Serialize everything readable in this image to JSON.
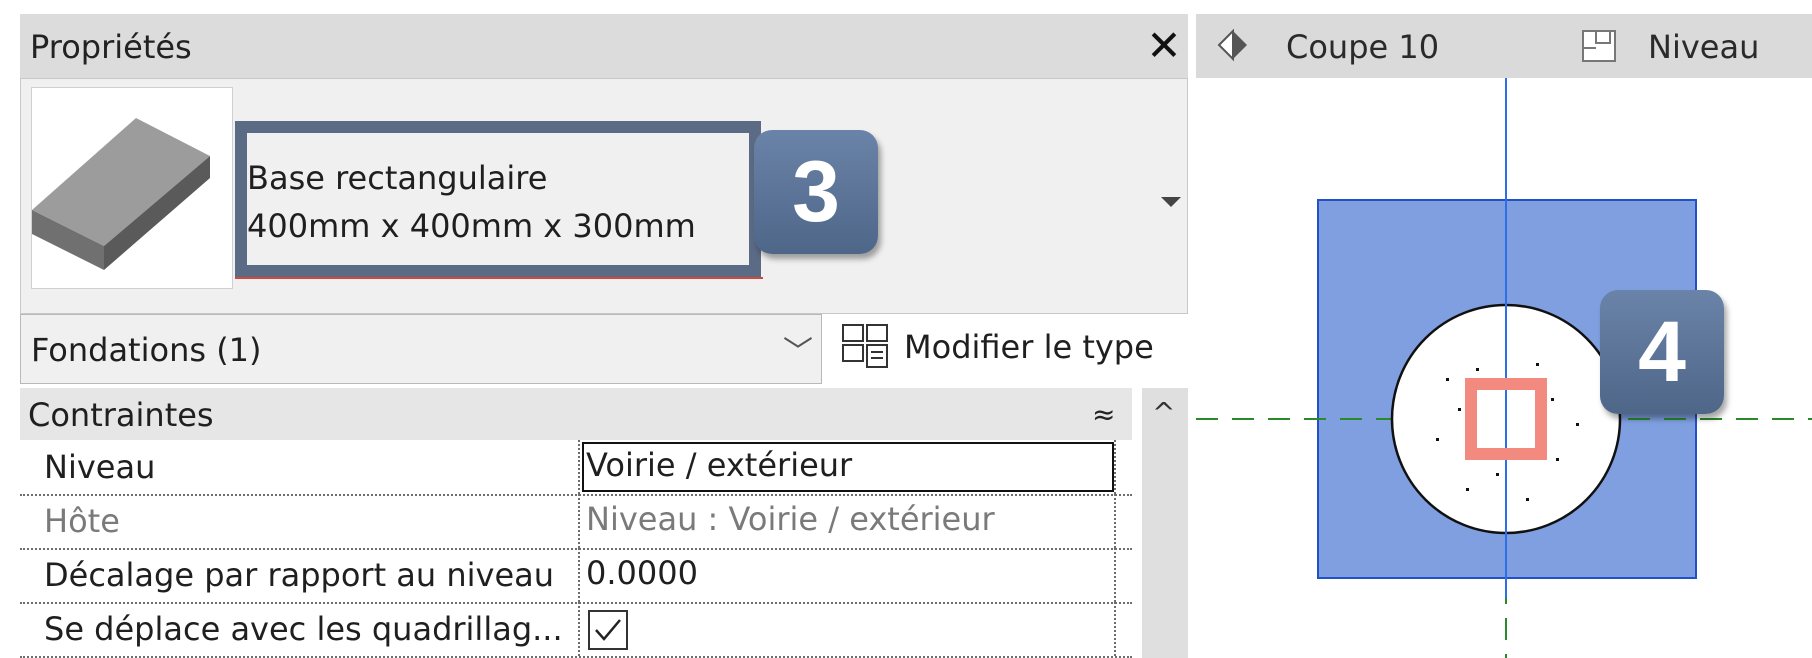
{
  "properties_panel": {
    "title": "Propriétés",
    "close_symbol": "✕",
    "type_selector": {
      "name_line1": "Base rectangulaire",
      "name_line2": "400mm x 400mm x 300mm",
      "dropdown_icon": "triangle-down-icon"
    },
    "callout_3": "3",
    "filter": {
      "label": "Fondations (1)",
      "chevron": "﹀"
    },
    "edit_type_label": "Modifier le type",
    "section": {
      "label": "Contraintes",
      "collapse_symbol": "≈"
    },
    "scroll_up_symbol": "^",
    "rows": [
      {
        "name": "Niveau",
        "value": "Voirie / extérieur"
      },
      {
        "name": "Hôte",
        "value": "Niveau : Voirie / extérieur"
      },
      {
        "name": "Décalage par rapport au niveau",
        "value": "0.0000"
      },
      {
        "name": "Se déplace avec les quadrillag...",
        "checked": true
      }
    ]
  },
  "view": {
    "tabs": [
      {
        "label": "Coupe 10",
        "icon": "section-view-icon"
      },
      {
        "label": "Niveau",
        "icon": "level-plan-icon"
      }
    ],
    "callout_4": "4"
  },
  "colors": {
    "footing_fill": "#7f9fe0",
    "footing_edge": "#2250c8",
    "grid_green": "#2a8a2a",
    "axis_blue": "#2d6fe6",
    "marker": "#f28a80",
    "callout_bg": "#5a7294",
    "highlight_box": "#5b6b86"
  }
}
